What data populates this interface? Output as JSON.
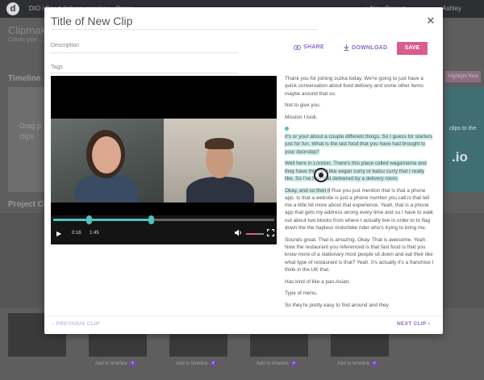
{
  "app": {
    "breadcrumb": "DIO / Food delivery services - Demo",
    "new_project": "+ New Project",
    "user_name": "Ashley",
    "heading": "Clipmaker",
    "subheading": "Create your ...",
    "timeline_label": "Timeline",
    "drop_text_line1": "Drag p",
    "drop_text_line2": "clips",
    "highlight_btn": "Highlight Reel",
    "right_text_line1": "clips to the",
    "right_text_io": ".io",
    "project_clips_label": "Project Clips",
    "thumb_label": "Add to timeline"
  },
  "modal": {
    "title": "Title of New Clip",
    "close_symbol": "✕",
    "description_label": "Description",
    "tags_label": "Tags",
    "share_label": "SHARE",
    "download_label": "DOWNLOAD",
    "save_label": "SAVE",
    "prev_label": "‹ PREVIOUS CLIP",
    "next_label": "NEXT CLIP ›"
  },
  "video": {
    "current_time": "0:16",
    "duration": "1:45",
    "progress_fraction": 0.16,
    "selection_start_fraction": 0.16,
    "selection_end_fraction": 0.44,
    "volume_fraction": 0.7
  },
  "transcript": {
    "p1": "Thank you for joining zuzka today. We're going to just have a quick conversation about food delivery and some other items maybe around that so.",
    "p2": "Not to give you.",
    "p3": "Mission I look.",
    "p4": "It's or your about a couple different things. So I guess for starters just for fun. What is the last food that you have had brought to your doorstep?",
    "p5": "Well here in London. There's this place called wagamama and they have this new like vegan curry or katsu curry that I really like. So I've had that delivered by a delivery room.",
    "p6_hl": "Okay, and so then if",
    "p6_rest": " Rue you just mention that is that a phone app. Is that a website is just a phone number you call is that tell me a little bit more about that experience. Yeah, that is a phone app that gets my address wrong every time and so I have to walk out about two blocks from where I actually live in order to to flag down the the hapless motorbike rider who's trying to bring me.",
    "p7": "Sounds great. That is amazing. Okay. That is awesome. Yeah. Now the restaurant you referenced is that fast food is that you know more of a stationary most people sit down and eat their like what type of restaurant is that? Yeah. It's actually it's a franchise I think in the UK that.",
    "p8": "Has kind of like a pan-Asian.",
    "p9": "Type of menu.",
    "p10": "So they're pretty easy to find around and they"
  },
  "colors": {
    "accent_purple": "#8a6ac0",
    "save_pink": "#d95c8f",
    "highlight_teal": "#c9ece8",
    "scrub_teal": "#4fc3bd"
  }
}
